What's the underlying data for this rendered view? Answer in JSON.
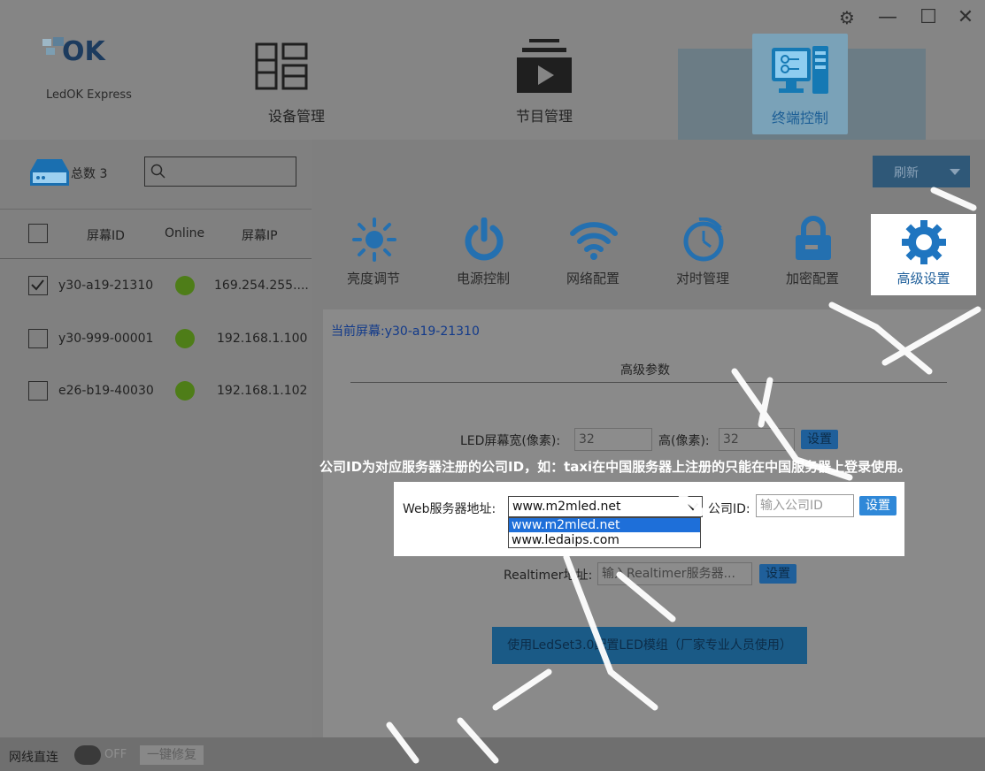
{
  "window": {
    "controls": {
      "settings": "⚙",
      "minimize": "—",
      "maximize": "☐",
      "close": "✕"
    }
  },
  "brand": {
    "logo_text": "OK",
    "name": "LedOK Express"
  },
  "nav": {
    "device_label": "设备管理",
    "program_label": "节目管理",
    "terminal_label": "终端控制"
  },
  "device_list": {
    "total_label": "总数 3",
    "search_placeholder": "",
    "headers": {
      "id": "屏幕ID",
      "online": "Online",
      "ip": "屏幕IP"
    },
    "rows": [
      {
        "id": "y30-a19-21310",
        "ip": "169.254.255....",
        "checked": true
      },
      {
        "id": "y30-999-00001",
        "ip": "192.168.1.100",
        "checked": false
      },
      {
        "id": "e26-b19-40030",
        "ip": "192.168.1.102",
        "checked": false
      }
    ]
  },
  "toolbar": {
    "refresh_label": "刷新"
  },
  "functions": {
    "brightness": "亮度调节",
    "power": "电源控制",
    "network": "网络配置",
    "time": "对时管理",
    "encrypt": "加密配置",
    "advanced": "高级设置"
  },
  "panel": {
    "current_screen": "当前屏幕:y30-a19-21310",
    "section_title": "高级参数",
    "width_label": "LED屏幕宽(像素):",
    "width_value": "32",
    "height_label": "高(像素):",
    "height_value": "32",
    "set_label": "设置",
    "company_note": "公司ID为对应服务器注册的公司ID，如：taxi在中国服务器上注册的只能在中国服务器上登录使用。",
    "web_server_label": "Web服务器地址:",
    "web_server_value": "www.m2mled.net",
    "web_server_options": [
      "www.m2mled.net",
      "www.ledaips.com"
    ],
    "company_id_label": "公司ID:",
    "company_id_placeholder": "输入公司ID",
    "realtimer_label": "Realtimer地址:",
    "realtimer_placeholder": "输入Realtimer服务器...",
    "ledset_button": "使用LedSet3.0配置LED模组（厂家专业人员使用）"
  },
  "bottom": {
    "direct_label": "网线直连",
    "toggle_state": "OFF",
    "repair_label": "一键修复"
  },
  "colors": {
    "accent": "#1f5f9a",
    "online": "#4e7d18",
    "link": "#123a8a"
  }
}
